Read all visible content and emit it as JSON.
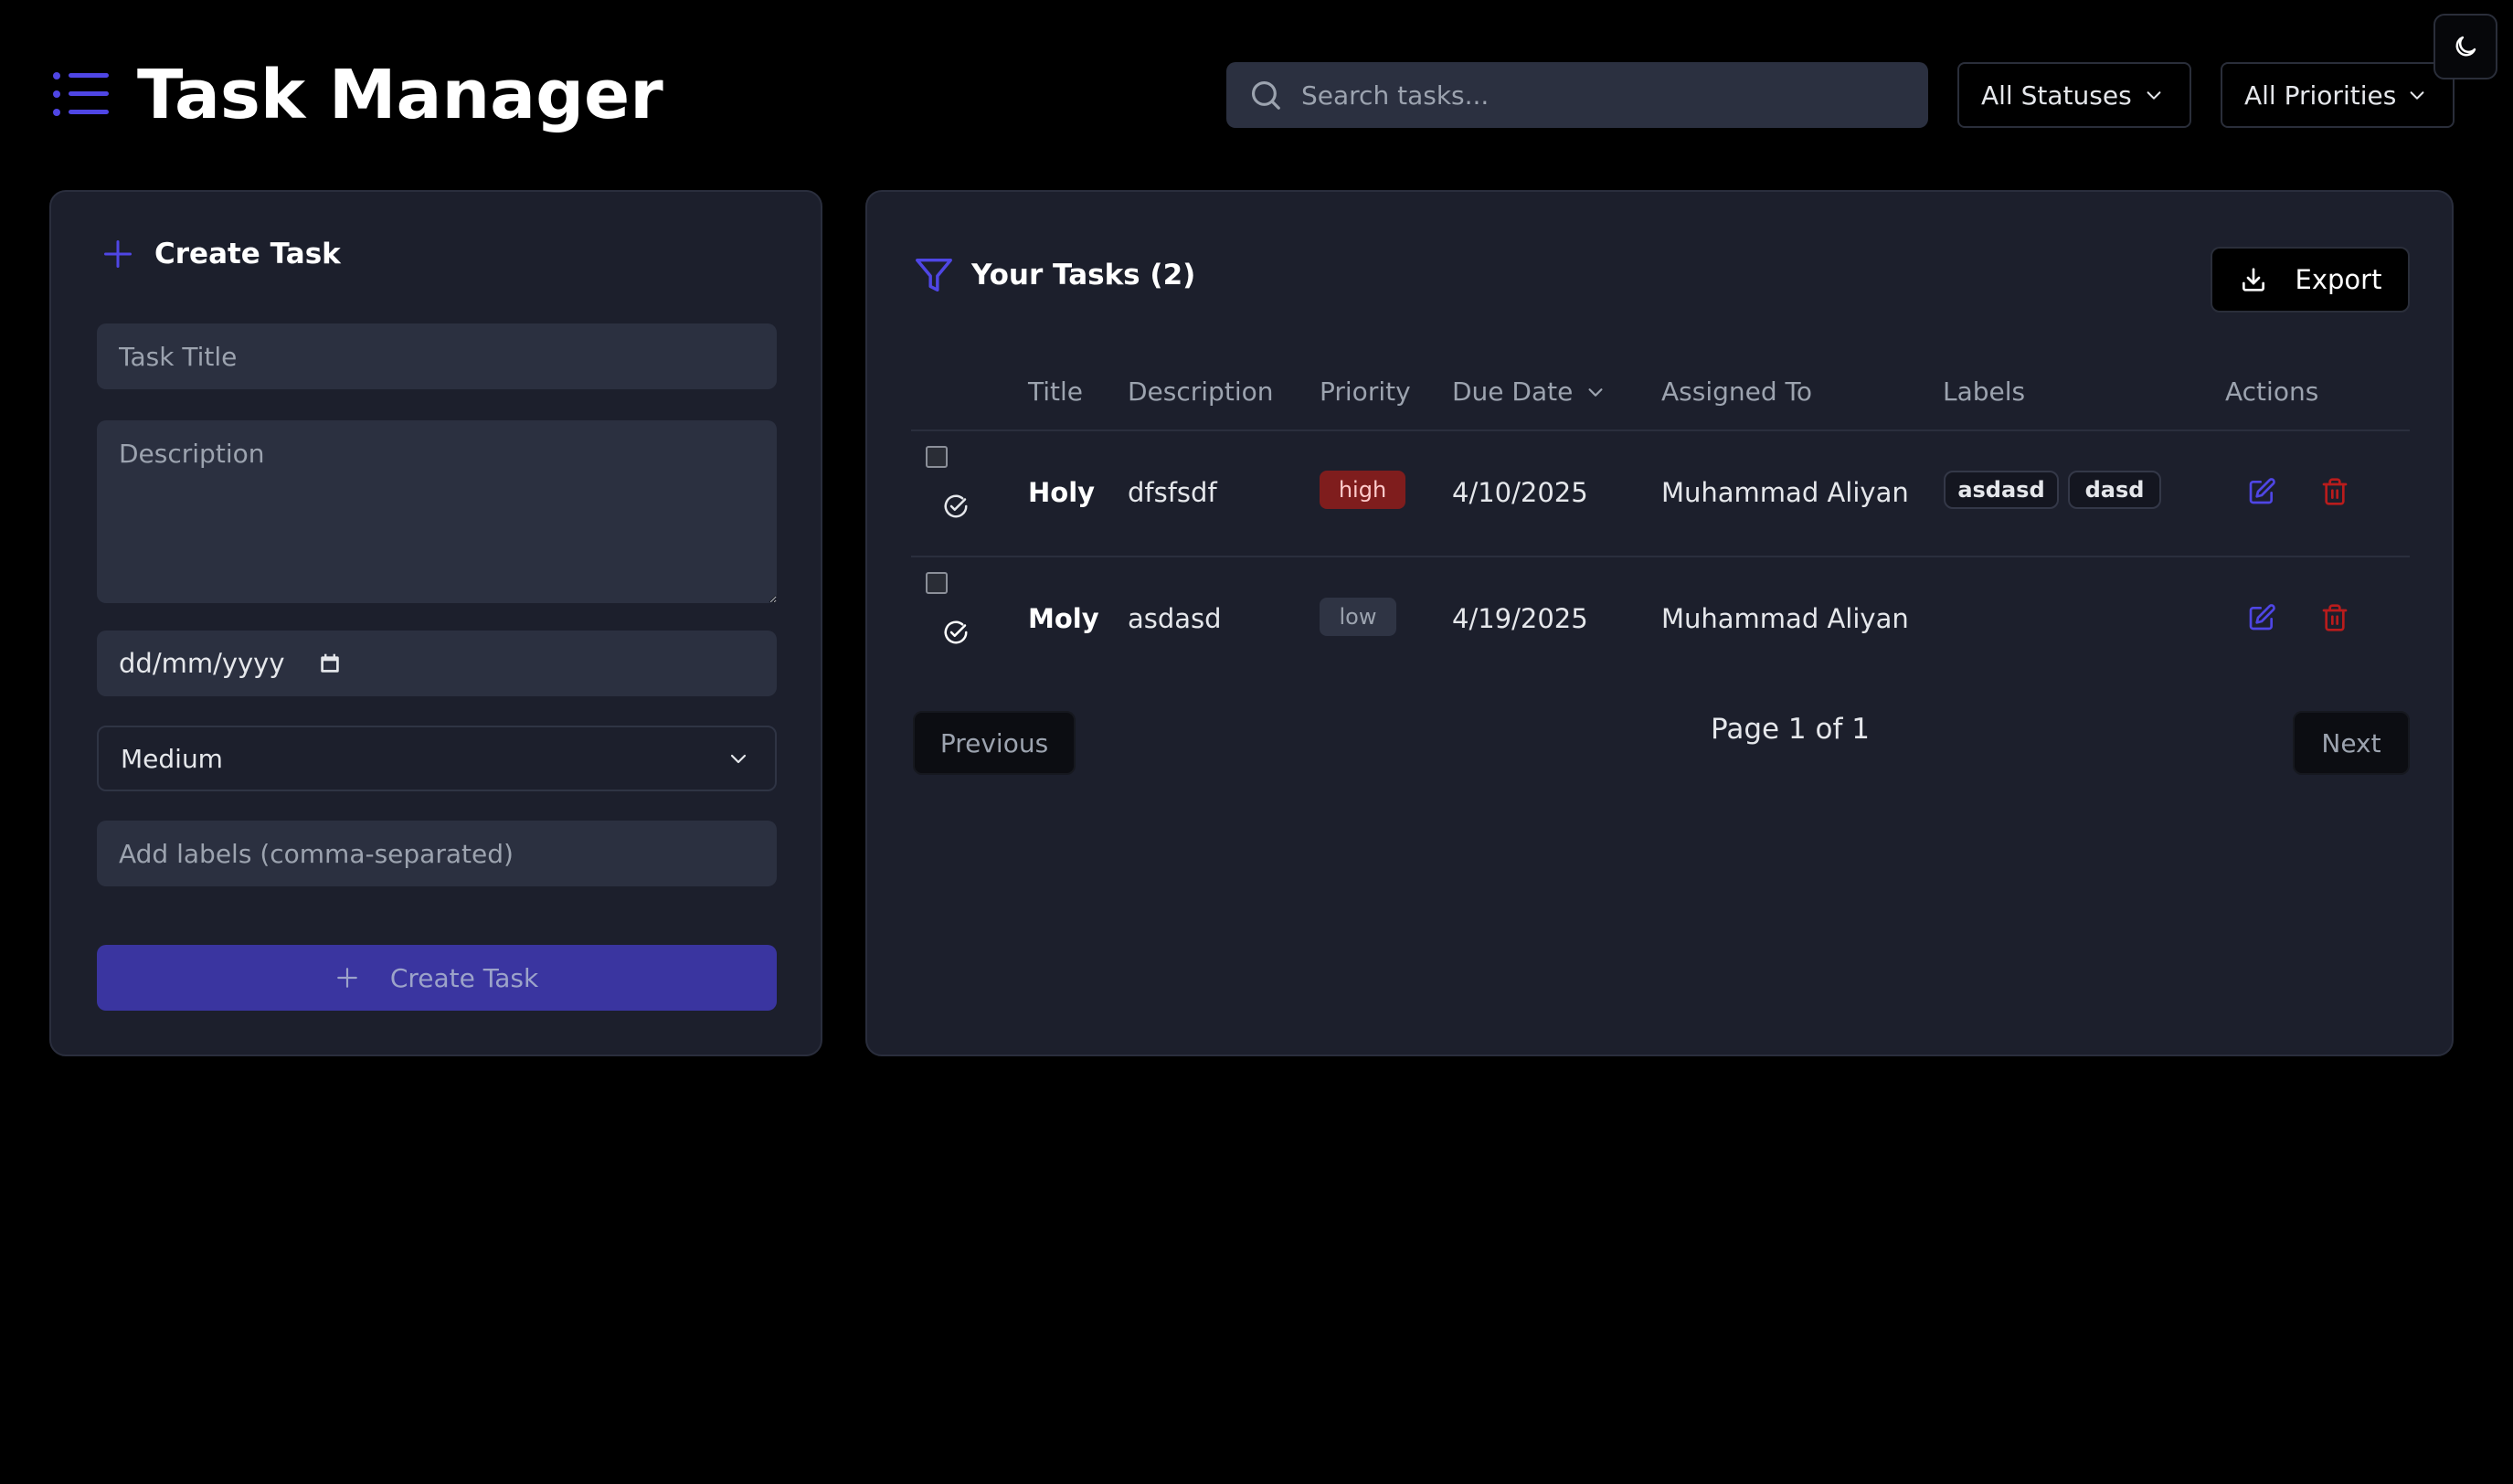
{
  "app": {
    "title": "Task Manager"
  },
  "header": {
    "search_placeholder": "Search tasks...",
    "status_filter": "All Statuses",
    "priority_filter": "All Priorities",
    "theme_toggle_icon": "moon-icon"
  },
  "create_form": {
    "heading": "Create Task",
    "title_placeholder": "Task Title",
    "description_placeholder": "Description",
    "date_placeholder": "dd/mm/yyyy",
    "priority_value": "Medium",
    "labels_placeholder": "Add labels (comma-separated)",
    "submit_label": "Create Task"
  },
  "tasks_panel": {
    "heading": "Your Tasks (2)",
    "export_label": "Export",
    "columns": {
      "title": "Title",
      "description": "Description",
      "priority": "Priority",
      "due_date": "Due Date",
      "assigned_to": "Assigned To",
      "labels": "Labels",
      "actions": "Actions"
    },
    "rows": [
      {
        "title": "Holy",
        "description": "dfsfsdf",
        "priority": "high",
        "due_date": "4/10/2025",
        "assigned_to": "Muhammad Aliyan",
        "labels": [
          "asdasd",
          "dasd"
        ]
      },
      {
        "title": "Moly",
        "description": "asdasd",
        "priority": "low",
        "due_date": "4/19/2025",
        "assigned_to": "Muhammad Aliyan",
        "labels": []
      }
    ],
    "pagination": {
      "previous_label": "Previous",
      "page_text": "Page 1 of 1",
      "next_label": "Next"
    }
  },
  "colors": {
    "accent": "#4f46e5",
    "danger": "#dc2626",
    "high_badge": "#7f1d1d",
    "panel_bg": "#1c1f2c"
  }
}
